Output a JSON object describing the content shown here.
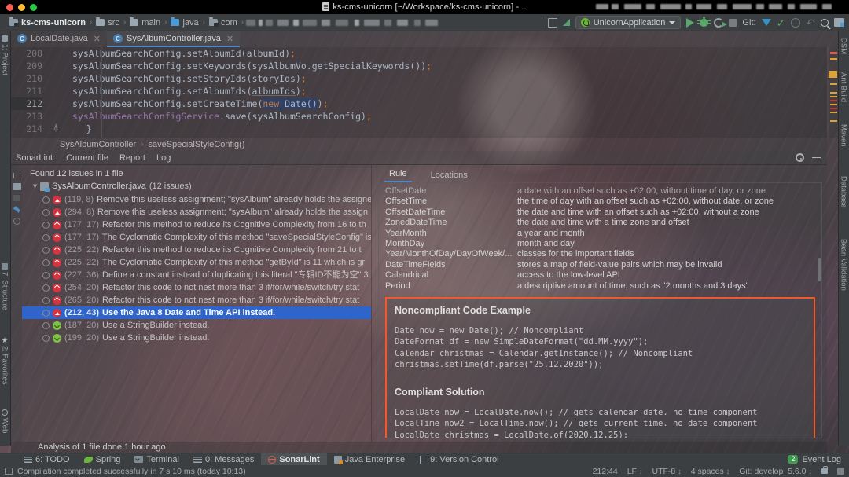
{
  "titlebar": {
    "title": "ks-cms-unicorn [~/Workspace/ks-cms-unicorn] - ..",
    "file_icon": "file-icon"
  },
  "breadcrumb": {
    "items": [
      {
        "label": "ks-cms-unicorn",
        "icon": "module-folder-icon"
      },
      {
        "label": "src",
        "icon": "folder-icon"
      },
      {
        "label": "main",
        "icon": "folder-icon"
      },
      {
        "label": "java",
        "icon": "source-folder-icon"
      },
      {
        "label": "com",
        "icon": "package-folder-icon"
      }
    ],
    "separator": "›"
  },
  "toolbar": {
    "run_config": "UnicornApplication",
    "git_label": "Git:",
    "icons": [
      "run-icon",
      "debug-icon",
      "run-with-coverage-icon",
      "stop-icon",
      "git-update-icon",
      "git-commit-icon",
      "git-history-icon",
      "git-rollback-icon",
      "search-everywhere-icon",
      "project-structure-icon"
    ]
  },
  "tabs": [
    {
      "label": "LocalDate.java",
      "active": false,
      "icon": "java-class-icon"
    },
    {
      "label": "SysAlbumController.java",
      "active": true,
      "icon": "java-class-icon"
    }
  ],
  "left_tool_strip": [
    {
      "label": "1: Project"
    },
    {
      "label": "7: Structure"
    },
    {
      "label": "2: Favorites"
    },
    {
      "label": "Web"
    }
  ],
  "right_tool_strip": [
    {
      "label": "DSM"
    },
    {
      "label": "Ant Build"
    },
    {
      "label": "Maven"
    },
    {
      "label": "Database"
    },
    {
      "label": "Bean Validation"
    }
  ],
  "editor": {
    "lines": [
      {
        "num": "208",
        "text": "sysAlbumSearchConfig.setAlbumId(albumId);"
      },
      {
        "num": "209",
        "text": "sysAlbumSearchConfig.setKeywords(sysAlbumVo.getSpecialKeywords());"
      },
      {
        "num": "210",
        "text": "sysAlbumSearchConfig.setStoryIds(storyIds);"
      },
      {
        "num": "211",
        "text": "sysAlbumSearchConfig.setAlbumIds(albumIds);"
      },
      {
        "num": "212",
        "text": "sysAlbumSearchConfig.setCreateTime(new Date());"
      },
      {
        "num": "213",
        "text": "sysAlbumSearchConfigService.save(sysAlbumSearchConfig);"
      },
      {
        "num": "214",
        "text": "}"
      }
    ],
    "current_line": "212"
  },
  "method_breadcrumb": {
    "class": "SysAlbumController",
    "separator": "›",
    "method": "saveSpecialStyleConfig()"
  },
  "sonarlint": {
    "title": "SonarLint:",
    "tabs": [
      "Current file",
      "Report",
      "Log"
    ],
    "settings_icon": "gear-icon",
    "minimize_icon": "minimize-icon",
    "summary": "Found 12 issues in 1 file",
    "file_node": "SysAlbumController.java",
    "file_node_count": "(12 issues)",
    "issues": [
      {
        "loc": "(119, 8)",
        "text": "Remove this useless assignment; \"sysAlbum\" already holds the assigne",
        "severity": "blocker",
        "selected": false
      },
      {
        "loc": "(294, 8)",
        "text": "Remove this useless assignment; \"sysAlbum\" already holds the assign",
        "severity": "blocker",
        "selected": false
      },
      {
        "loc": "(177, 17)",
        "text": "Refactor this method to reduce its Cognitive Complexity from 16 to th",
        "severity": "critical",
        "selected": false
      },
      {
        "loc": "(177, 17)",
        "text": "The Cyclomatic Complexity of this method \"saveSpecialStyleConfig\" is",
        "severity": "critical",
        "selected": false
      },
      {
        "loc": "(225, 22)",
        "text": "Refactor this method to reduce its Cognitive Complexity from 21 to t",
        "severity": "critical",
        "selected": false
      },
      {
        "loc": "(225, 22)",
        "text": "The Cyclomatic Complexity of this method \"getById\" is 11 which is gr",
        "severity": "critical",
        "selected": false
      },
      {
        "loc": "(227, 36)",
        "text": "Define a constant instead of duplicating this literal \"专辑ID不能为空\" 3",
        "severity": "critical",
        "selected": false
      },
      {
        "loc": "(254, 20)",
        "text": "Refactor this code to not nest more than 3 if/for/while/switch/try stat",
        "severity": "critical",
        "selected": false
      },
      {
        "loc": "(265, 20)",
        "text": "Refactor this code to not nest more than 3 if/for/while/switch/try stat",
        "severity": "critical",
        "selected": false
      },
      {
        "loc": "(212, 43)",
        "text": "Use the Java 8 Date and Time API instead.",
        "severity": "blocker",
        "selected": true
      },
      {
        "loc": "(187, 20)",
        "text": "Use a StringBuilder instead.",
        "severity": "minor",
        "selected": false
      },
      {
        "loc": "(199, 20)",
        "text": "Use a StringBuilder instead.",
        "severity": "minor",
        "selected": false
      }
    ]
  },
  "rule_panel": {
    "tabs": [
      {
        "label": "Rule",
        "active": true
      },
      {
        "label": "Locations",
        "active": false
      }
    ],
    "glossary": [
      {
        "term": "OffsetDate",
        "desc": "a date with an offset such as +02:00, without time of day, or zone"
      },
      {
        "term": "OffsetTime",
        "desc": "the time of day with an offset such as +02:00, without date, or zone"
      },
      {
        "term": "OffsetDateTime",
        "desc": "the date and time with an offset such as +02:00, without a zone"
      },
      {
        "term": "ZonedDateTime",
        "desc": "the date and time with a time zone and offset"
      },
      {
        "term": "YearMonth",
        "desc": "a year and month"
      },
      {
        "term": "MonthDay",
        "desc": "month and day"
      },
      {
        "term": "Year/MonthOfDay/DayOfWeek/...",
        "desc": "classes for the important fields"
      },
      {
        "term": "DateTimeFields",
        "desc": "stores a map of field-value pairs which may be invalid"
      },
      {
        "term": "Calendrical",
        "desc": "access to the low-level API"
      },
      {
        "term": "Period",
        "desc": "a descriptive amount of time, such as \"2 months and 3 days\""
      }
    ],
    "noncompliant_title": "Noncompliant Code Example",
    "noncompliant_code": "Date now = new Date(); // Noncompliant\nDateFormat df = new SimpleDateFormat(\"dd.MM.yyyy\");\nCalendar christmas = Calendar.getInstance(); // Noncompliant\nchristmas.setTime(df.parse(\"25.12.2020\"));",
    "compliant_title": "Compliant Solution",
    "compliant_code": "LocalDate now = LocalDate.now(); // gets calendar date. no time component\nLocalTime now2 = LocalTime.now(); // gets current time. no date component\nLocalDate christmas = LocalDate.of(2020,12,25);",
    "highlight_color": "#f05a28"
  },
  "analysis_status": "Analysis of 1 file done 1 hour ago",
  "tool_windows": [
    {
      "label": "6: TODO",
      "mnemonic": "6",
      "icon": "todo-icon",
      "active": false
    },
    {
      "label": "Spring",
      "mnemonic": "",
      "icon": "spring-icon",
      "active": false
    },
    {
      "label": "Terminal",
      "mnemonic": "",
      "icon": "terminal-icon",
      "active": false
    },
    {
      "label": "0: Messages",
      "mnemonic": "0",
      "icon": "messages-icon",
      "active": false
    },
    {
      "label": "SonarLint",
      "mnemonic": "",
      "icon": "sonarlint-icon",
      "active": true
    },
    {
      "label": "Java Enterprise",
      "mnemonic": "",
      "icon": "java-enterprise-icon",
      "active": false
    },
    {
      "label": "9: Version Control",
      "mnemonic": "9",
      "icon": "version-control-icon",
      "active": false
    }
  ],
  "event_log": {
    "count": "2",
    "label": "Event Log"
  },
  "statusbar": {
    "compile_message": "Compilation completed successfully in 7 s 10 ms (today 10:13)",
    "caret": "212:44",
    "line_separator": "LF",
    "encoding": "UTF-8",
    "indent": "4 spaces",
    "git_branch": "Git: develop_5.6.0",
    "lock_icon": "read-only-lock-icon",
    "trash_icon": "memory-indicator-icon"
  }
}
